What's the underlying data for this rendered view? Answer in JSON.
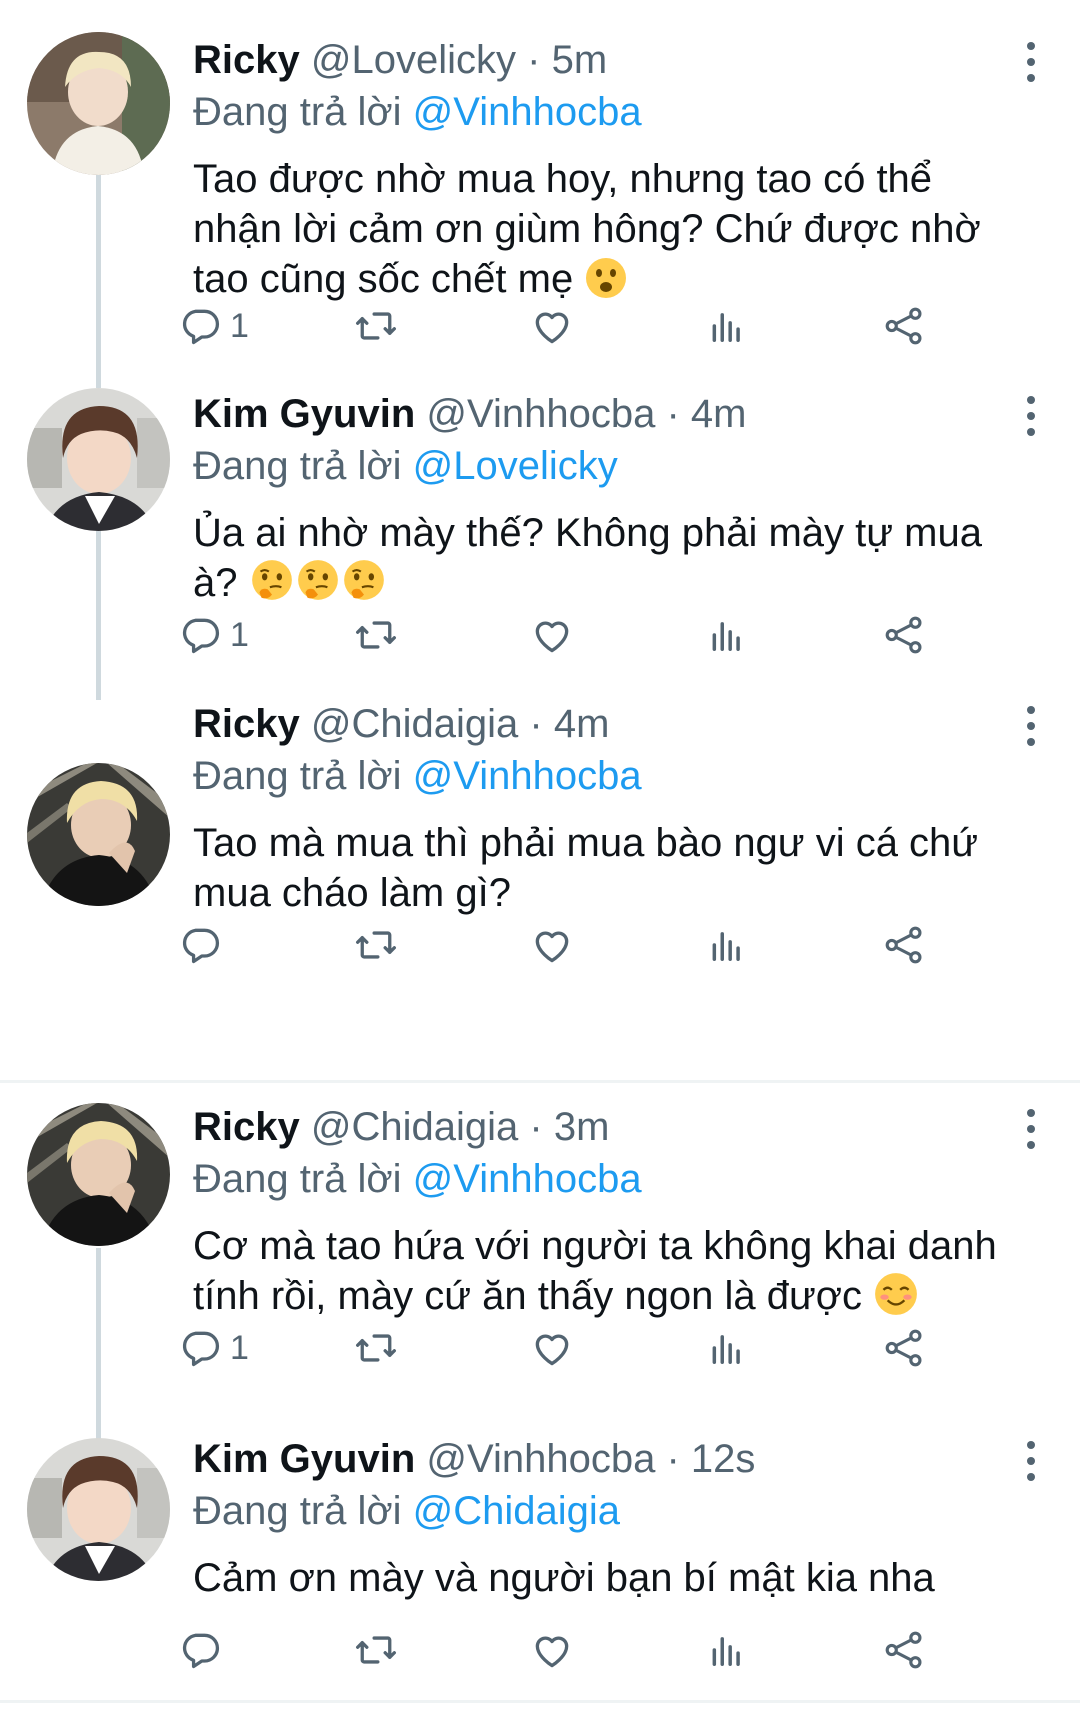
{
  "tweets": [
    {
      "name": "Ricky",
      "handle": "@Lovelicky",
      "time": "5m",
      "reply_prefix": "Đang trả lời",
      "reply_to": "@Vinhhocba",
      "text": "Tao được nhờ mua hoy, nhưng tao có thể nhận lời cảm ơn giùm hông? Chứ được nhờ tao cũng sốc chết mẹ",
      "emoji": [
        "frowning-face-emoji"
      ],
      "reply_count": "1"
    },
    {
      "name": "Kim Gyuvin",
      "handle": "@Vinhhocba",
      "time": "4m",
      "reply_prefix": "Đang trả lời",
      "reply_to": "@Lovelicky",
      "text": "Ủa ai nhờ mày thế? Không phải mày tự mua à?",
      "emoji": [
        "thinking-face-emoji",
        "thinking-face-emoji",
        "thinking-face-emoji"
      ],
      "reply_count": "1"
    },
    {
      "name": "Ricky",
      "handle": "@Chidaigia",
      "time": "4m",
      "reply_prefix": "Đang trả lời",
      "reply_to": "@Vinhhocba",
      "text": "Tao mà mua thì phải mua bào ngư vi cá chứ mua cháo làm gì?",
      "emoji": [],
      "reply_count": ""
    },
    {
      "name": "Ricky",
      "handle": "@Chidaigia",
      "time": "3m",
      "reply_prefix": "Đang trả lời",
      "reply_to": "@Vinhhocba",
      "text": "Cơ mà tao hứa với người ta không khai danh tính rồi, mày cứ ăn thấy ngon là được",
      "emoji": [
        "smiling-face-emoji"
      ],
      "reply_count": "1"
    },
    {
      "name": "Kim Gyuvin",
      "handle": "@Vinhhocba",
      "time": "12s",
      "reply_prefix": "Đang trả lời",
      "reply_to": "@Chidaigia",
      "text": "Cảm ơn mày và người bạn bí mật kia nha",
      "emoji": [],
      "reply_count": ""
    }
  ],
  "separator": "·",
  "icons": {
    "reply": "reply-icon",
    "retweet": "retweet-icon",
    "like": "like-icon",
    "views": "views-icon",
    "share": "share-icon",
    "more": "more-icon"
  },
  "colors": {
    "name": "#0f1419",
    "secondary": "#536471",
    "mention": "#1d9bf0",
    "thread_line": "#cfd9de",
    "divider": "#eff3f4"
  }
}
